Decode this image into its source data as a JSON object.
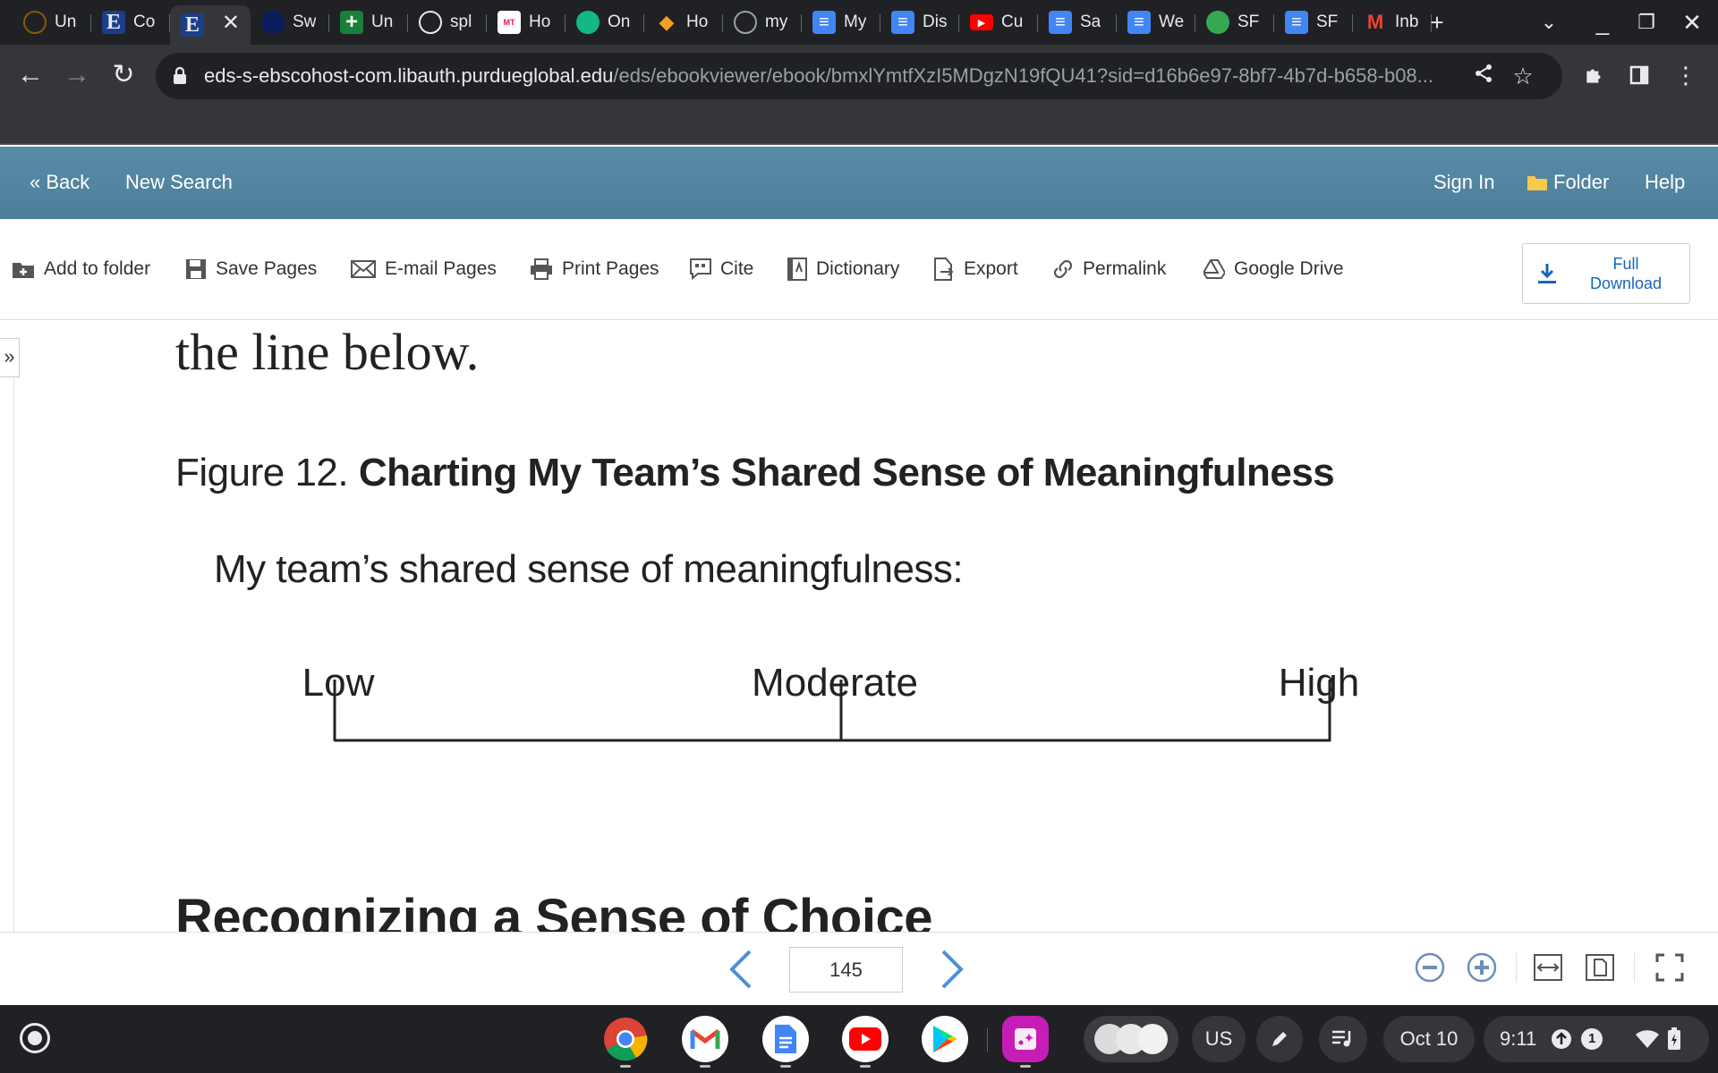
{
  "browser": {
    "tabs": [
      {
        "title": "Un",
        "favicon": "globe-dark-icon",
        "color": "#8a5a00"
      },
      {
        "title": "Co",
        "favicon": "ebsco-e-icon",
        "color": "#1a73e8"
      },
      {
        "title": "",
        "favicon": "ebsco-e-icon",
        "color": "#1a73e8"
      },
      {
        "title": "Sw",
        "favicon": "dark-circle-icon",
        "color": "#0b1d5f"
      },
      {
        "title": "Un",
        "favicon": "green-plus-icon",
        "color": "#188038"
      },
      {
        "title": "spl",
        "favicon": "globe-icon",
        "color": "#e8eaed"
      },
      {
        "title": "Ho",
        "favicon": "mtbf-icon",
        "color": "#d81b60"
      },
      {
        "title": "On",
        "favicon": "teal-t-icon",
        "color": "#12b886"
      },
      {
        "title": "Ho",
        "favicon": "cube-icon",
        "color": "#f4a020"
      },
      {
        "title": "my",
        "favicon": "globe-gray-icon",
        "color": "#9aa0a6"
      },
      {
        "title": "My",
        "favicon": "docs-icon",
        "color": "#4285f4"
      },
      {
        "title": "Dis",
        "favicon": "docs-icon",
        "color": "#4285f4"
      },
      {
        "title": "Cu",
        "favicon": "youtube-icon",
        "color": "#ff0000"
      },
      {
        "title": "Sa",
        "favicon": "docs-icon",
        "color": "#4285f4"
      },
      {
        "title": "We",
        "favicon": "docs-icon",
        "color": "#4285f4"
      },
      {
        "title": "SF",
        "favicon": "compass-icon",
        "color": "#34a853"
      },
      {
        "title": "SF",
        "favicon": "docs-icon",
        "color": "#4285f4"
      },
      {
        "title": "Inb",
        "favicon": "gmail-icon",
        "color": "#ea4335"
      }
    ],
    "url_host": "eds-s-ebscohost-com.libauth.purdueglobal.edu",
    "url_path": "/eds/ebookviewer/ebook/bmxlYmtfXzI5MDgzN19fQU41?sid=d16b6e97-8bf7-4b7d-b658-b08..."
  },
  "header": {
    "back": "« Back",
    "new_search": "New Search",
    "sign_in": "Sign In",
    "folder": "Folder",
    "help": "Help"
  },
  "actions": {
    "add_to_folder": "Add to folder",
    "save_pages": "Save Pages",
    "email_pages": "E-mail Pages",
    "print_pages": "Print Pages",
    "cite": "Cite",
    "dictionary": "Dictionary",
    "export": "Export",
    "permalink": "Permalink",
    "google_drive": "Google Drive",
    "full_download_line1": "Full",
    "full_download_line2": "Download"
  },
  "page": {
    "text_above": "the line below.",
    "figure_label": "Figure 12. ",
    "figure_title": "Charting My Team’s Shared Sense of Meaningfulness",
    "question": "My team’s shared sense of meaningfulness:",
    "scale_low": "Low",
    "scale_moderate": "Moderate",
    "scale_high": "High",
    "next_heading": "Recognizing a Sense of Choice"
  },
  "pagination": {
    "page_number": "145"
  },
  "shelf": {
    "keyboard_layout": "US",
    "date": "Oct 10",
    "time": "9:11",
    "notification_count": "1"
  }
}
